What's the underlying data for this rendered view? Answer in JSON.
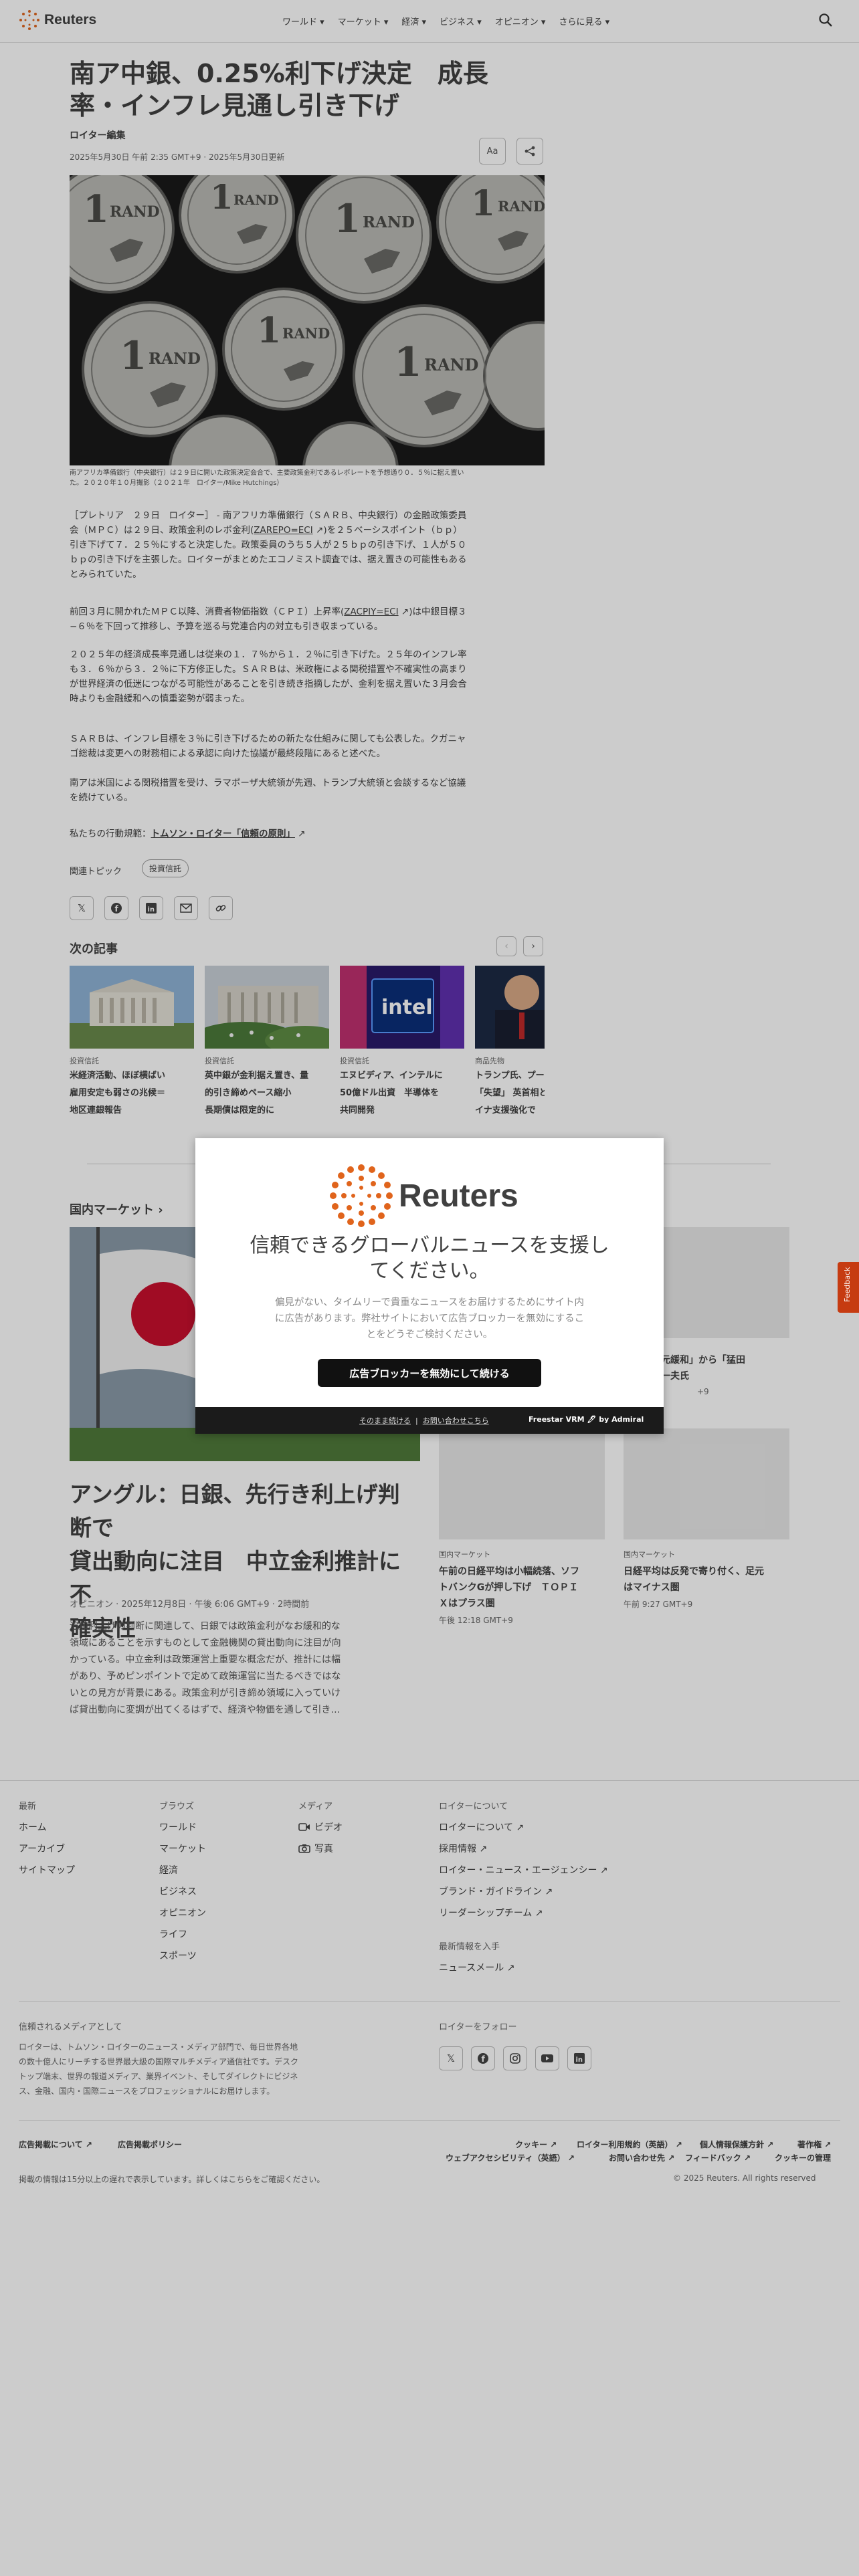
{
  "header": {
    "logo": "Reuters",
    "nav": [
      "ワールド",
      "マーケット",
      "経済",
      "ビジネス",
      "オピニオン",
      "さらに見る"
    ]
  },
  "article": {
    "title_line1": "南ア中銀、0.25%利下げ決定　成長",
    "title_line2": "率・インフレ見通し引き下げ",
    "byline": "ロイター編集",
    "date": "2025年5月30日 午前 2:35 GMT+9 · 2025年5月30日更新",
    "text_size_label": "Aa",
    "caption_line1": "南アフリカ準備銀行（中央銀行）は２９日に開いた政策決定会合で、主要政策金利であるレポレートを予想通り０．５％に据え置い",
    "caption_line2": "た。２０２０年１０月撮影（２０２１年　ロイター/Mike Hutchings）",
    "p1_line1": "［プレトリア　２９日　ロイター］ - 南アフリカ準備銀行（ＳＡＲＢ、中央銀行）の金融政策委員",
    "p1_line2a": "会（ＭＰＣ）は２９日、政策金利のレポ金利(",
    "p1_ticker": "ZAREPO=ECI",
    "p1_line2b": ")を２５ベーシスポイント（ｂｐ）",
    "p1_line3": "引き下げて７．２５％にすると決定した。政策委員のうち５人が２５ｂｐの引き下げ、１人が５０",
    "p1_line4": "ｂｐの引き下げを主張した。ロイターがまとめたエコノミスト調査では、据え置きの可能性もある",
    "p1_line5": "とみられていた。",
    "p2_line1a": "前回３月に開かれたＭＰＣ以降、消費者物価指数（ＣＰＩ）上昇率(",
    "p2_ticker": "ZACPIY=ECI",
    "p2_line1b": ")は中銀目標３",
    "p2_line2": "−６％を下回って推移し、予算を巡る与党連合内の対立も引き収まっている。",
    "p3_line1": "２０２５年の経済成長率見通しは従来の１．７％から１．２％に引き下げた。２５年のインフレ率",
    "p3_line2": "も３．６％から３．２％に下方修正した。ＳＡＲＢは、米政権による関税措置や不確実性の高まり",
    "p3_line3": "が世界経済の低迷につながる可能性があることを引き続き指摘したが、金利を据え置いた３月会合",
    "p3_line4": "時よりも金融緩和への慎重姿勢が弱まった。",
    "p4_line1": "ＳＡＲＢは、インフレ目標を３％に引き下げるための新たな仕組みに関しても公表した。クガニャ",
    "p4_line2": "ゴ総裁は変更への財務相による承認に向けた協議が最終段階にあると述べた。",
    "p5_line1": "南アは米国による関税措置を受け、ラマポーザ大統領が先週、トランプ大統領と会談するなど協議",
    "p5_line2": "を続けている。",
    "standards_prefix": "私たちの行動規範：",
    "standards_link": "トムソン・ロイター「信頼の原則」",
    "topics_label": "関連トピック",
    "topic_pill": "投資信託"
  },
  "next": {
    "title": "次の記事",
    "cards": [
      {
        "category": "投資信託",
        "line1": "米経済活動、ほぼ横ばい",
        "line2": "雇用安定も弱さの兆候＝",
        "line3": "地区連銀報告"
      },
      {
        "category": "投資信託",
        "line1": "英中銀が金利据え置き、量",
        "line2": "的引き締めペース縮小",
        "line3": "長期債は限定的に"
      },
      {
        "category": "投資信託",
        "line1": "エヌビディア、インテルに",
        "line2": "50億ドル出資　半導体を",
        "line3": "共同開発"
      },
      {
        "category": "商品先物",
        "line1": "トランプ氏、プーチン",
        "line2": "「失望」 英首相と",
        "line3": "イナ支援強化で"
      }
    ]
  },
  "market": {
    "section_title": "国内マーケット",
    "main_title_line1": "アングル：日銀、先行き利上げ判断で",
    "main_title_line2": "貸出動向に注目　中立金利推計に不",
    "main_title_line3": "確実性",
    "main_meta": "オピニオン · 2025年12月8日 · 午後 6:06 GMT+9 · 2時間前",
    "desc_line1": "追加利上げの判断に関連して、日銀では政策金利がなお緩和的な",
    "desc_line2": "領域にあることを示すものとして金融機関の貸出動向に注目が向",
    "desc_line3": "かっている。中立金利は政策運営上重要な概念だが、推計には幅",
    "desc_line4": "があり、予めピンポイントで定めて政策運営に当たるべきではな",
    "desc_line5": "いとの見方が背景にある。政策金利が引き締め領域に入っていけ",
    "desc_line6": "ば貸出動向に変調が出てくるはずで、経済や物価を通して引き…",
    "side": [
      {
        "category": "",
        "line1": "「超異次元緩和」から「猛田",
        "line2": "へ一門閥一夫氏",
        "time": "+9"
      },
      {
        "category": "国内マーケット",
        "line1": "午前の日経平均は小幅続落、ソフ",
        "line2": "トバンクGが押し下げ　ＴＯＰＩ",
        "line3": "Ｘはプラス圏",
        "time": "午後 12:18 GMT+9"
      },
      {
        "category": "国内マーケット",
        "line1": "日経平均は反発で寄り付く、足元",
        "line2": "はマイナス圏",
        "time": "午前 9:27 GMT+9"
      }
    ]
  },
  "footer": {
    "col1_title": "最新",
    "col1": [
      "ホーム",
      "アーカイブ",
      "サイトマップ"
    ],
    "col2_title": "ブラウズ",
    "col2": [
      "ワールド",
      "マーケット",
      "経済",
      "ビジネス",
      "オピニオン",
      "ライフ",
      "スポーツ"
    ],
    "col3_title": "メディア",
    "col3": [
      "ビデオ",
      "写真"
    ],
    "col4_title": "ロイターについて",
    "col4": [
      "ロイターについて",
      "採用情報",
      "ロイター・ニュース・エージェンシー",
      "ブランド・ガイドライン",
      "リーダーシップチーム"
    ],
    "news_title": "最新情報を入手",
    "newsletter": "ニュースメール",
    "trusted_title": "信頼されるメディアとして",
    "trusted_line1": "ロイターは、トムソン・ロイターのニュース・メディア部門で、毎日世界各地",
    "trusted_line2": "の数十億人にリーチする世界最大級の国際マルチメディア通信社です。デスク",
    "trusted_line3": "トップ端末、世界の報道メディア、業界イベント、そしてダイレクトにビジネ",
    "trusted_line4": "ス、金融、国内・国際ニュースをプロフェッショナルにお届けします。",
    "follow_title": "ロイターをフォロー",
    "ads_about": "広告掲載について",
    "ads_policy": "広告掲載ポリシー",
    "legal1": [
      "クッキー",
      "ロイター利用規約（英語）",
      "個人情報保護方針",
      "著作権"
    ],
    "legal2": [
      "ウェブアクセシビリティ（英語）",
      "お問い合わせ先",
      "フィードバック",
      "クッキーの管理"
    ],
    "delay_note": "掲載の情報は15分以上の遅れで表示しています。詳しくはこちらをご確認ください。",
    "copyright": "© 2025 Reuters. All rights reserved"
  },
  "modal": {
    "logo": "Reuters",
    "heading_line1": "信頼できるグローバルニュースを支援し",
    "heading_line2": "てください。",
    "body_line1": "偏見がない、タイムリーで貴重なニュースをお届けするためにサイト内",
    "body_line2": "に広告があります。弊社サイトにおいて広告ブロッカーを無効にするこ",
    "body_line3": "とをどうぞご検討ください。",
    "button": "広告ブロッカーを無効にして続ける",
    "link1": "そのまま続ける",
    "link2": "お問い合わせこちら",
    "brand": "Freestar VRM  🖊 by Admiral"
  },
  "feedback": "Feedback"
}
